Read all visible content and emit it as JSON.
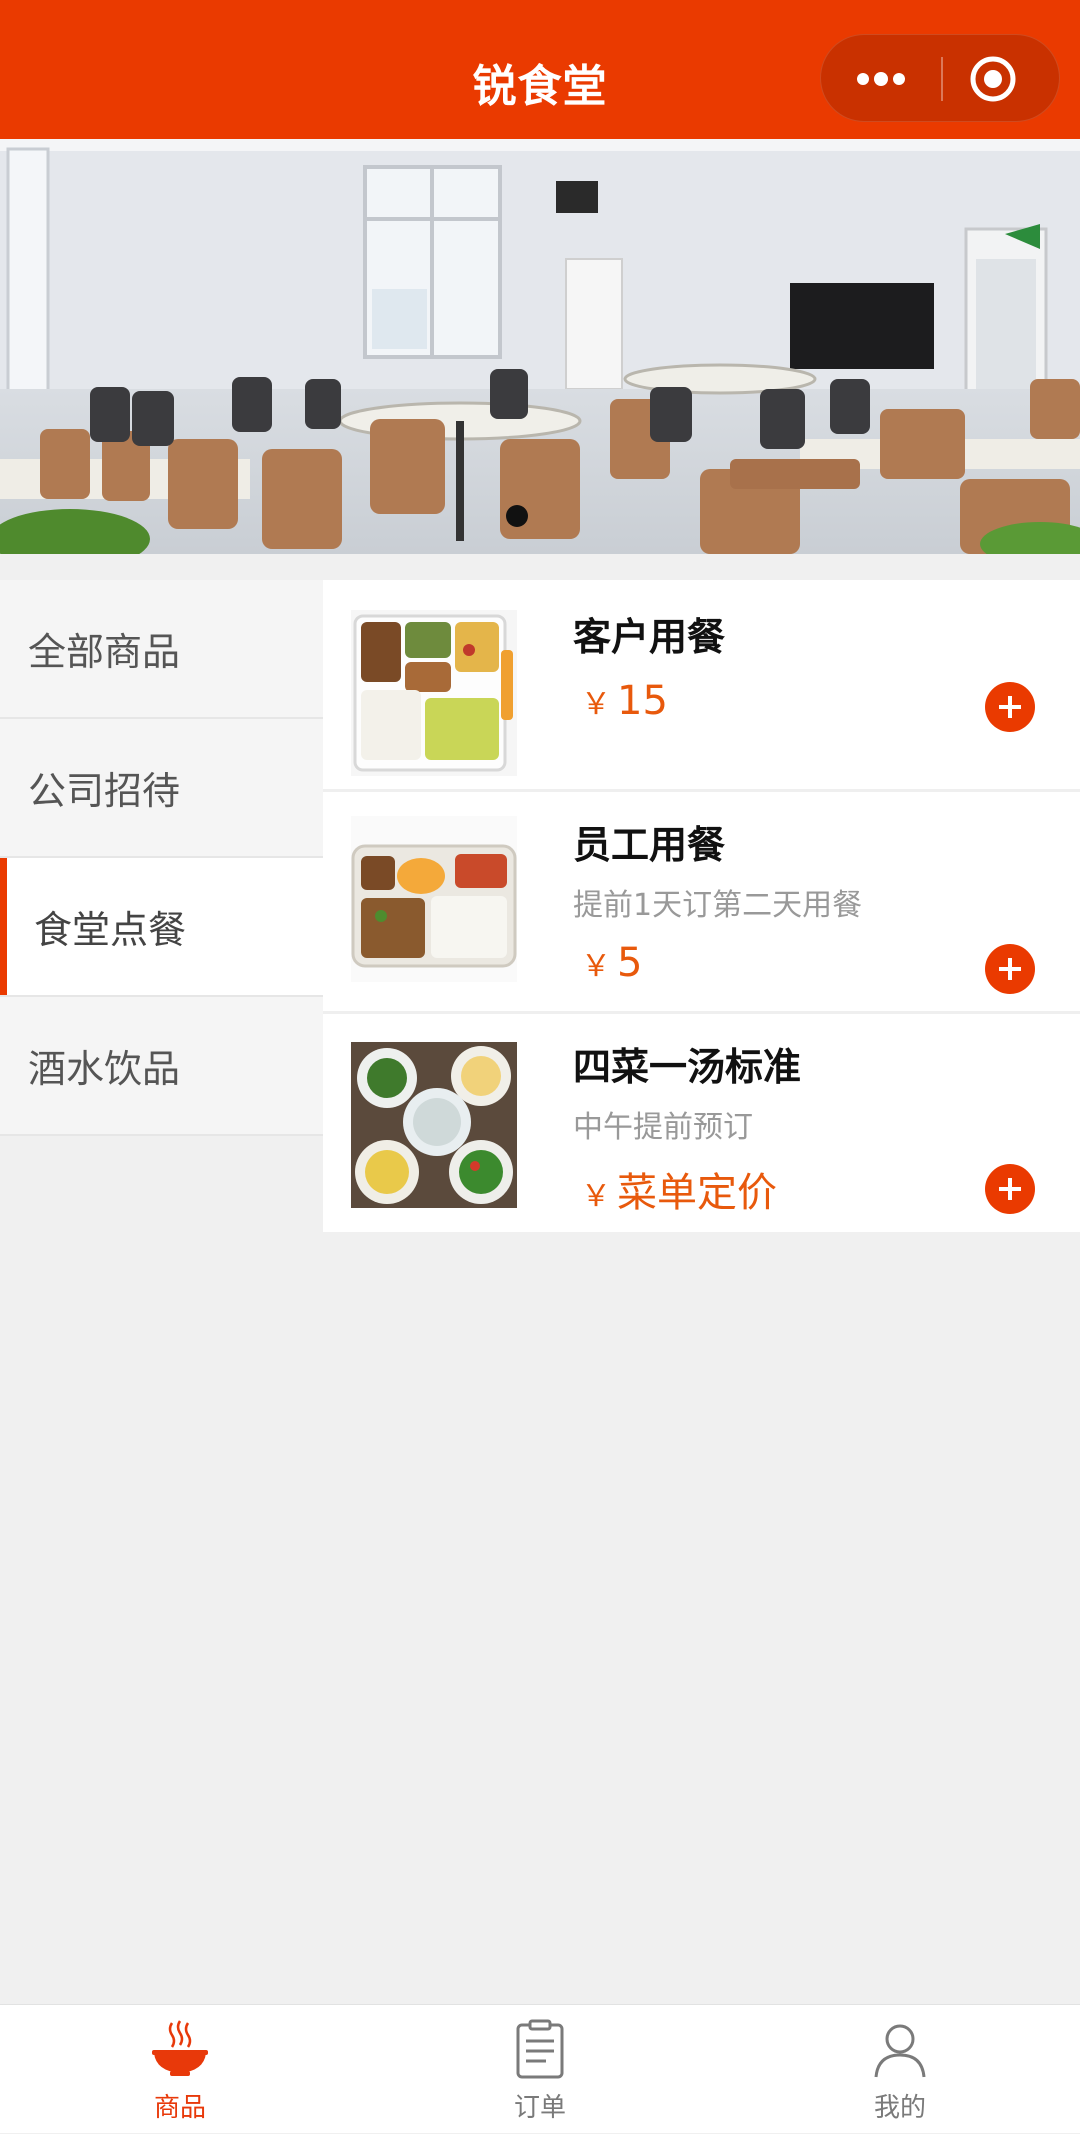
{
  "header": {
    "title": "锐食堂",
    "capsule": {
      "menu_icon": "more-dots-icon",
      "close_icon": "target-circle-icon"
    }
  },
  "banner": {
    "image": "canteen-dining-hall-photo",
    "slide_count": 1,
    "active_slide": 1
  },
  "sidebar": {
    "items": [
      {
        "label": "全部商品",
        "active": false
      },
      {
        "label": "公司招待",
        "active": false
      },
      {
        "label": "食堂点餐",
        "active": true
      },
      {
        "label": "酒水饮品",
        "active": false
      }
    ]
  },
  "products": [
    {
      "name": "客户用餐",
      "desc": "",
      "currency": "￥",
      "price": "15",
      "image": "takeout-box-meal-photo"
    },
    {
      "name": "员工用餐",
      "desc": "提前1天订第二天用餐",
      "currency": "￥",
      "price": "5",
      "image": "tray-meal-photo"
    },
    {
      "name": "四菜一汤标准",
      "desc": "中午提前预订",
      "currency": "￥",
      "price": "菜单定价",
      "image": "four-dishes-soup-photo"
    }
  ],
  "tabbar": {
    "items": [
      {
        "label": "商品",
        "icon": "food-bowl-icon",
        "active": true
      },
      {
        "label": "订单",
        "icon": "order-clipboard-icon",
        "active": false
      },
      {
        "label": "我的",
        "icon": "user-profile-icon",
        "active": false
      }
    ]
  },
  "colors": {
    "primary": "#ea3a00",
    "price": "#e8590c",
    "background": "#f0f0f0"
  }
}
